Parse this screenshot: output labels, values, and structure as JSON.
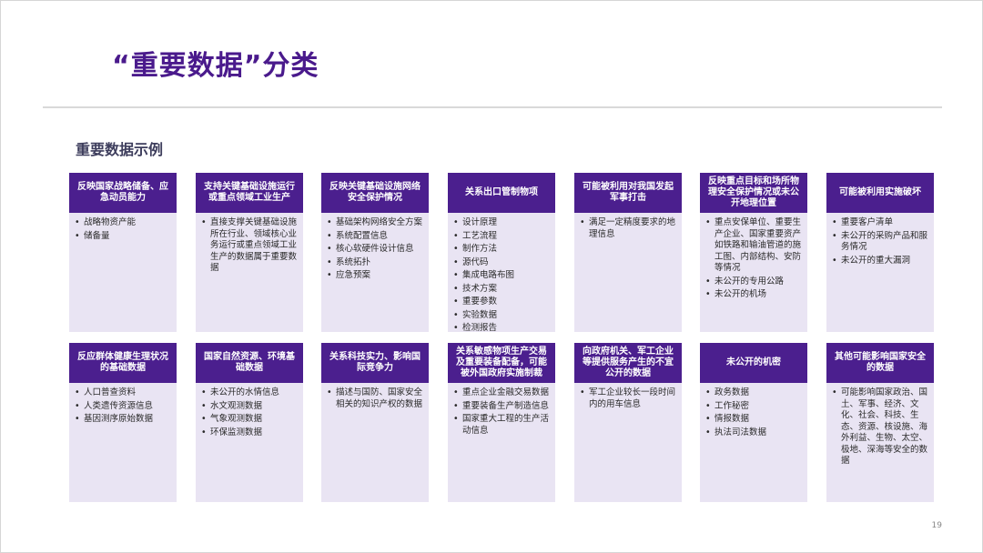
{
  "slide": {
    "title": "“重要数据”分类",
    "section_title": "重要数据示例",
    "page_number": "19"
  },
  "cards": [
    {
      "header": "反映国家战略储备、应急动员能力",
      "items": [
        "战略物资产能",
        "储备量"
      ]
    },
    {
      "header": "支持关键基础设施运行或重点领域工业生产",
      "items": [
        "直接支撑关键基础设施所在行业、领域核心业务运行或重点领域工业生产的数据属于重要数据"
      ]
    },
    {
      "header": "反映关键基础设施网络安全保护情况",
      "items": [
        "基础架构网络安全方案",
        "系统配置信息",
        "核心软硬件设计信息",
        "系统拓扑",
        "应急预案"
      ]
    },
    {
      "header": "关系出口管制物项",
      "items": [
        "设计原理",
        "工艺流程",
        "制作方法",
        "源代码",
        "集成电路布图",
        "技术方案",
        "重要参数",
        "实验数据",
        "检测报告"
      ]
    },
    {
      "header": "可能被利用对我国发起军事打击",
      "items": [
        "满足一定精度要求的地理信息"
      ]
    },
    {
      "header": "反映重点目标和场所物理安全保护情况或未公开地理位置",
      "items": [
        "重点安保单位、重要生产企业、国家重要资产如铁路和输油管道的施工图、内部结构、安防等情况",
        "未公开的专用公路",
        "未公开的机场"
      ]
    },
    {
      "header": "可能被利用实施破坏",
      "items": [
        "重要客户清单",
        "未公开的采购产品和服务情况",
        "未公开的重大漏洞"
      ]
    },
    {
      "header": "反应群体健康生理状况的基础数据",
      "items": [
        "人口普查资料",
        "人类遗传资源信息",
        "基因测序原始数据"
      ]
    },
    {
      "header": "国家自然资源、环境基础数据",
      "items": [
        "未公开的水情信息",
        "水文观测数据",
        "气象观测数据",
        "环保监测数据"
      ]
    },
    {
      "header": "关系科技实力、影响国际竞争力",
      "items": [
        "描述与国防、国家安全相关的知识产权的数据"
      ]
    },
    {
      "header": "关系敏感物项生产交易及重要装备配备，可能被外国政府实施制裁",
      "items": [
        "重点企业金融交易数据",
        "重要装备生产制造信息",
        "国家重大工程的生产活动信息"
      ]
    },
    {
      "header": "向政府机关、军工企业等提供服务产生的不宜公开的数据",
      "items": [
        "军工企业较长一段时间内的用车信息"
      ]
    },
    {
      "header": "未公开的机密",
      "items": [
        "政务数据",
        "工作秘密",
        "情报数据",
        "执法司法数据"
      ]
    },
    {
      "header": "其他可能影响国家安全的数据",
      "items": [
        "可能影响国家政治、国土、军事、经济、文化、社会、科技、生态、资源、核设施、海外利益、生物、太空、极地、深海等安全的数据"
      ]
    }
  ]
}
